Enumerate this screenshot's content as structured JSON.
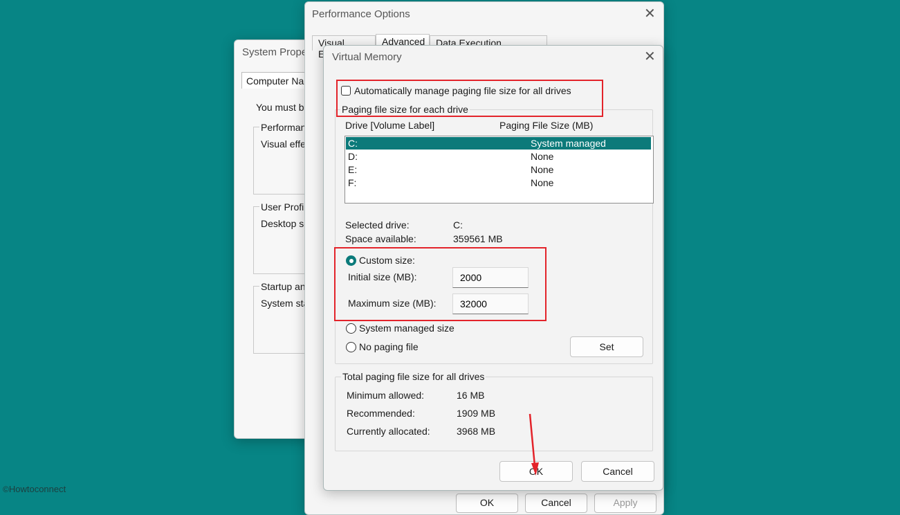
{
  "system_properties": {
    "title": "System Prope",
    "tab": "Computer Nam",
    "note": "You must be",
    "sections": [
      {
        "label": "Performanc",
        "text": "Visual effec"
      },
      {
        "label": "User Profile",
        "text": "Desktop se"
      },
      {
        "label": "Startup and",
        "text": "System sta"
      }
    ]
  },
  "performance_options": {
    "title": "Performance Options",
    "tabs": [
      "Visual Effects",
      "Advanced",
      "Data Execution Prevention"
    ],
    "buttons": [
      "OK",
      "Cancel",
      "Apply"
    ]
  },
  "virtual_memory": {
    "title": "Virtual Memory",
    "auto_manage_label": "Automatically manage paging file size for all drives",
    "auto_manage_checked": false,
    "drive_group_label": "Paging file size for each drive",
    "columns": [
      "Drive  [Volume Label]",
      "Paging File Size (MB)"
    ],
    "drives": [
      {
        "drive": "C:",
        "size": "System managed",
        "selected": true
      },
      {
        "drive": "D:",
        "size": "None",
        "selected": false
      },
      {
        "drive": "E:",
        "size": "None",
        "selected": false
      },
      {
        "drive": "F:",
        "size": "None",
        "selected": false
      }
    ],
    "selected_drive_label": "Selected drive:",
    "selected_drive_value": "C:",
    "space_available_label": "Space available:",
    "space_available_value": "359561 MB",
    "custom_size_label": "Custom size:",
    "initial_size_label": "Initial size (MB):",
    "initial_size_value": "2000",
    "maximum_size_label": "Maximum size (MB):",
    "maximum_size_value": "32000",
    "system_managed_label": "System managed size",
    "no_paging_label": "No paging file",
    "set_button": "Set",
    "total_group_label": "Total paging file size for all drives",
    "minimum_allowed_label": "Minimum allowed:",
    "minimum_allowed_value": "16 MB",
    "recommended_label": "Recommended:",
    "recommended_value": "1909 MB",
    "currently_allocated_label": "Currently allocated:",
    "currently_allocated_value": "3968 MB",
    "ok_button": "OK",
    "cancel_button": "Cancel"
  },
  "watermark": {
    "symbol": "©",
    "text": "Howtoconnect"
  },
  "colors": {
    "desktop": "#078585",
    "highlight": "#0c7a7a",
    "annotation": "#e3232a"
  }
}
